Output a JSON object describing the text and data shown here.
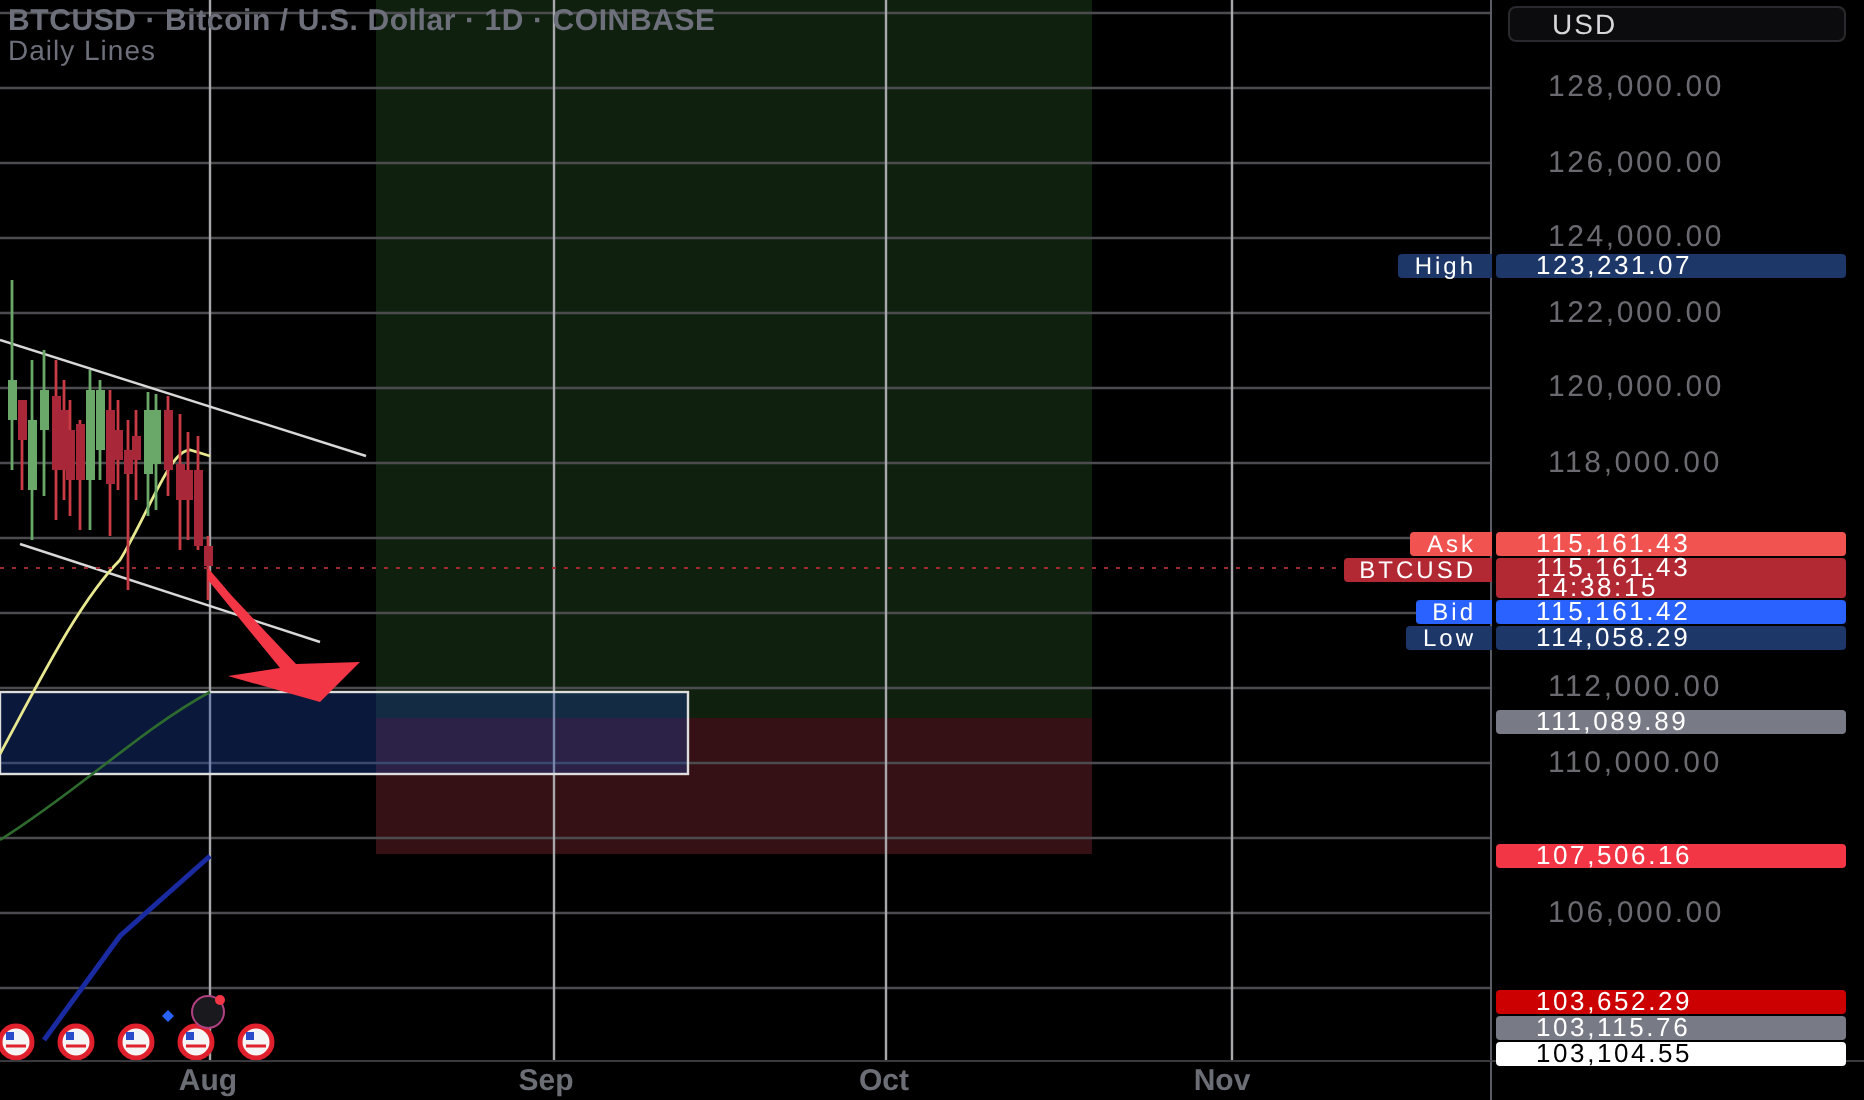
{
  "header": {
    "symbol_line": "BTCUSD · Bitcoin / U.S. Dollar · 1D · COINBASE",
    "indicator": "Daily Lines"
  },
  "price_axis": {
    "currency": "USD",
    "ticks": [
      "128,000.00",
      "126,000.00",
      "124,000.00",
      "122,000.00",
      "120,000.00",
      "118,000.00",
      "112,000.00",
      "110,000.00",
      "106,000.00"
    ],
    "labels": [
      {
        "kind": "marker",
        "tag": "High",
        "value": "123,231.07",
        "color": "#1c3768"
      },
      {
        "kind": "marker",
        "tag": "Ask",
        "value": "115,161.43",
        "color": "#f05350"
      },
      {
        "kind": "current",
        "tag": "BTCUSD",
        "value": "115,161.43",
        "time": "14:38:15",
        "color": "#b22833"
      },
      {
        "kind": "marker",
        "tag": "Bid",
        "value": "115,161.42",
        "color": "#2962ff"
      },
      {
        "kind": "marker",
        "tag": "Low",
        "value": "114,058.29",
        "color": "#1c3768"
      },
      {
        "kind": "line",
        "value": "111,089.89",
        "color": "#787b86"
      },
      {
        "kind": "line",
        "value": "107,506.16",
        "color": "#f23645"
      },
      {
        "kind": "line",
        "value": "103,652.29",
        "color": "#cc0000"
      },
      {
        "kind": "line",
        "value": "103,115.76",
        "color": "#787b86"
      },
      {
        "kind": "line",
        "value": "103,104.55",
        "color": "#ffffff"
      }
    ]
  },
  "time_axis": [
    "Aug",
    "Sep",
    "Oct",
    "Nov"
  ]
}
